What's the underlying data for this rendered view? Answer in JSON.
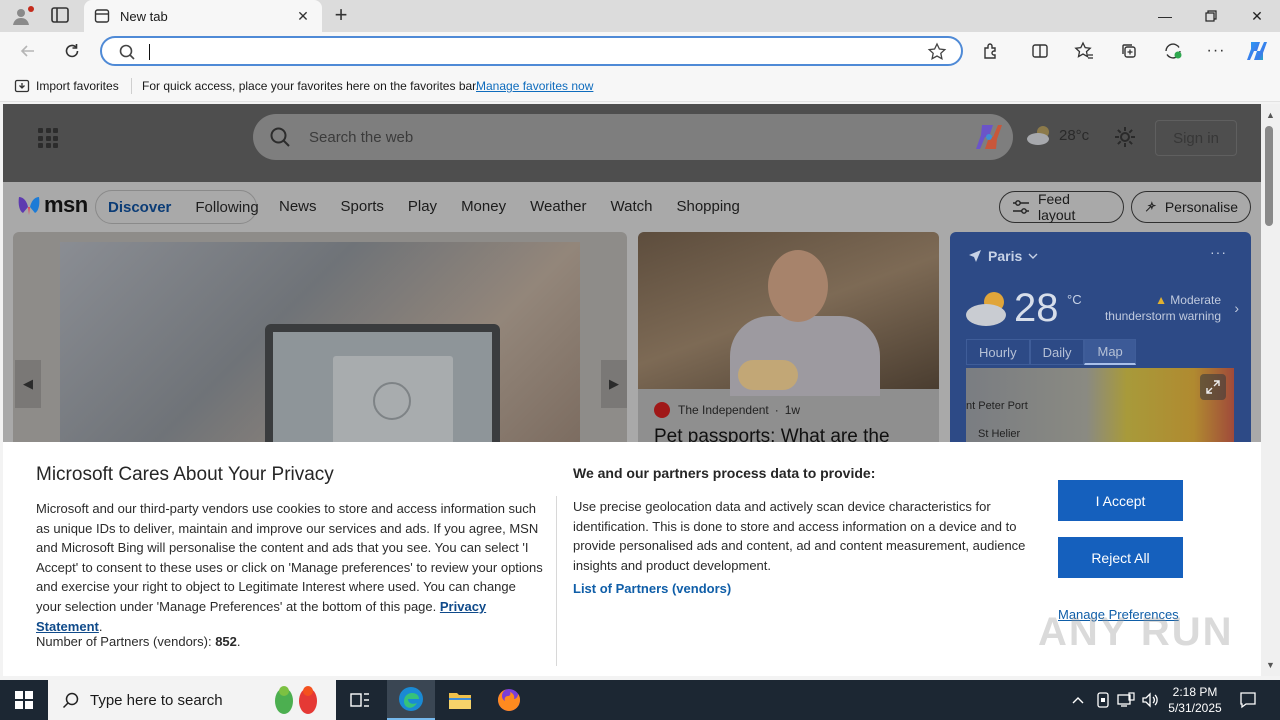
{
  "browser": {
    "tab_title": "New tab",
    "new_tab_symbol": "+",
    "address_value": "",
    "favorites": {
      "import_label": "Import favorites",
      "hint": "For quick access, place your favorites here on the favorites bar.",
      "manage_link": "Manage favorites now"
    },
    "icons": [
      "profile-icon",
      "tabs-icon",
      "close-icon",
      "back-icon",
      "refresh-icon",
      "search-icon",
      "star-icon",
      "extensions-icon",
      "split-screen-icon",
      "favorites-icon",
      "collections-icon",
      "performance-icon",
      "more-icon",
      "copilot-icon",
      "minimize-icon",
      "restore-icon"
    ]
  },
  "msn": {
    "search_placeholder": "Search the web",
    "header_weather_temp": "28°c",
    "signin": "Sign in",
    "logo_text": "msn",
    "segments": [
      "Discover",
      "Following"
    ],
    "nav_links": [
      "News",
      "Sports",
      "Play",
      "Money",
      "Weather",
      "Watch",
      "Shopping"
    ],
    "feed_layout": "Feed layout",
    "personalise": "Personalise",
    "news_card": {
      "source": "The Independent",
      "age": "1w",
      "headline": "Pet passports: What are the"
    },
    "weather_card": {
      "location": "Paris",
      "temp": "28",
      "unit": "°C",
      "warning_line1": "Moderate",
      "warning_line2": "thunderstorm warning",
      "tabs": [
        "Hourly",
        "Daily",
        "Map"
      ],
      "active_tab": "Map",
      "map_labels": [
        "nt Peter Port",
        "St Helier"
      ]
    }
  },
  "privacy": {
    "title": "Microsoft Cares About Your Privacy",
    "body": "Microsoft and our third-party vendors use cookies to store and access information such as unique IDs to deliver, maintain and improve our services and ads. If you agree, MSN and Microsoft Bing will personalise the content and ads that you see. You can select 'I Accept' to consent to these uses or click on 'Manage preferences' to review your options and exercise your right to object to Legitimate Interest where used.  You can change your selection under 'Manage Preferences' at the bottom of this page.",
    "privacy_link": "Privacy Statement",
    "partners_label": "Number of Partners (vendors):",
    "partners_count": "852",
    "purposes_heading": "We and our partners process data to provide:",
    "purposes_body": "Use precise geolocation data and actively scan device characteristics for identification. This is done to store and access information on a device and to provide personalised ads and content, ad and content measurement, audience insights and product development.",
    "vendors_link": "List of Partners (vendors)",
    "accept": "I Accept",
    "reject": "Reject All",
    "manage": "Manage Preferences"
  },
  "watermark": "ANY RUN",
  "taskbar": {
    "search_placeholder": "Type here to search",
    "time": "2:18 PM",
    "date": "5/31/2025"
  },
  "colors": {
    "accent": "#1560bd",
    "link": "#0f5ea8",
    "address_border": "#4f8ad6",
    "taskbar": "#1c2733"
  }
}
